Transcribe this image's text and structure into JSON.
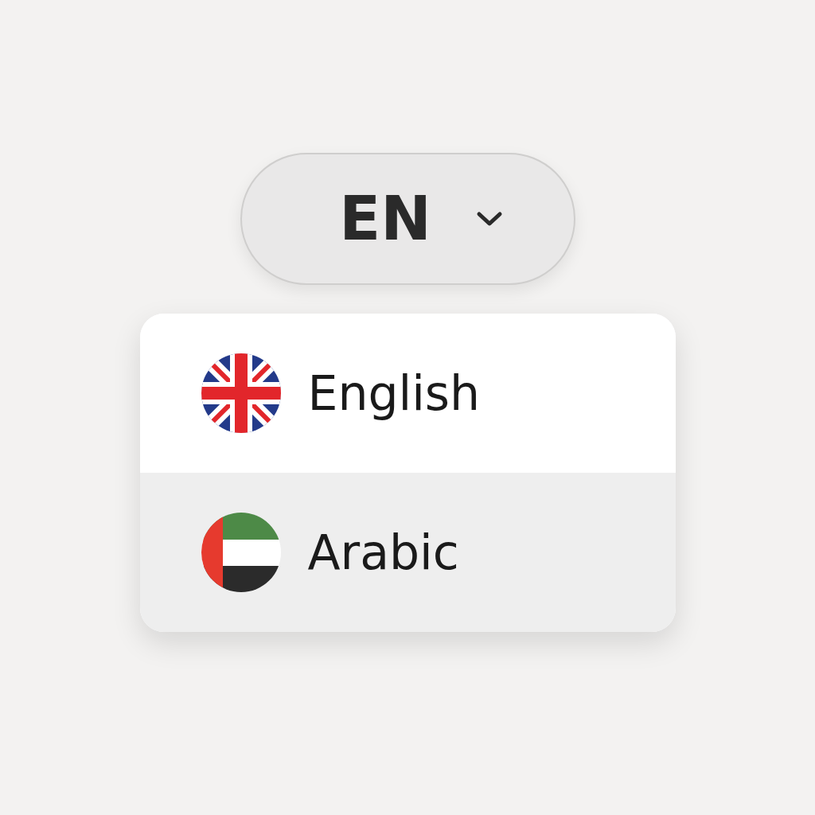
{
  "language_button": {
    "label": "EN"
  },
  "menu": {
    "items": [
      {
        "label": "English",
        "kind": "uk",
        "selected": false
      },
      {
        "label": "Arabic",
        "kind": "uae",
        "selected": true
      }
    ]
  }
}
